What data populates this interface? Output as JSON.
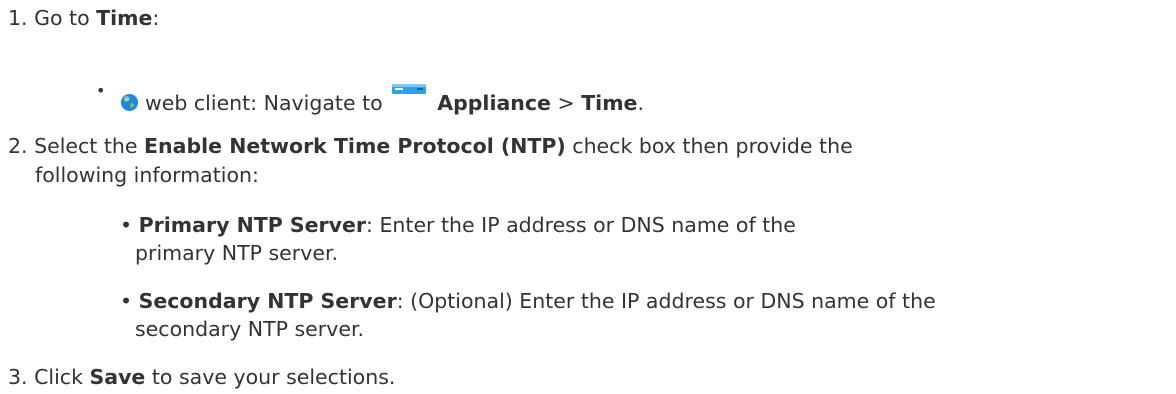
{
  "steps": [
    {
      "number": "1.",
      "prefix": "Go to ",
      "bold": "Time",
      "suffix": ":",
      "sub": {
        "client": "web client: Navigate to ",
        "menu1": "Appliance",
        "sep": " > ",
        "menu2": "Time",
        "end": "."
      }
    },
    {
      "number": "2.",
      "prefix": "Select the ",
      "bold": "Enable Network Time Protocol (NTP)",
      "suffix": " check box then provide the",
      "line2": "following information:",
      "bullets": [
        {
          "label": "Primary NTP Server",
          "text": ": Enter the IP address or DNS name of the",
          "text2": "primary  NTP  server."
        },
        {
          "label": "Secondary NTP Server",
          "text": ": (Optional) Enter the IP address or DNS name of the",
          "text2": "secondary NTP server."
        }
      ]
    },
    {
      "number": "3.",
      "prefix": "Click ",
      "bold": "Save",
      "suffix": " to save your selections."
    }
  ],
  "icons": {
    "globe": "globe-icon",
    "appliance": "appliance-icon"
  },
  "colors": {
    "text": "#333333",
    "icon_blue": "#1e88e5"
  }
}
